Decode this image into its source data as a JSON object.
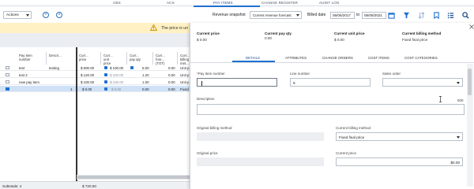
{
  "nav": {
    "tabs": [
      "CBS",
      "ACS",
      "PAY ITEMS",
      "CHANGE REGISTER",
      "AUDIT LOG"
    ],
    "active": "PAY ITEMS"
  },
  "toolbar": {
    "actions_label": "Actions",
    "revenue_snapshot_label": "Revenue snapshot",
    "revenue_snapshot_value": "Current revenue forecast",
    "billed_date_label": "Billed date",
    "date_from": "06/06/2017",
    "to_label": "to",
    "date_to": "06/08/2021"
  },
  "banner": {
    "message": "The price is un"
  },
  "grid": {
    "headers": [
      "Pay item number",
      "Descri...",
      "Curr... price",
      "Curr... unit price",
      "Curr... pay qty",
      "Curr... fore... (TOT)",
      "Curr... billing met..."
    ],
    "rows": [
      {
        "selected": false,
        "number": "test",
        "description": "testing",
        "price": "$ 500.00",
        "unit_price": "$ 100.00",
        "pay_qty": "5.00",
        "fore": "0.00",
        "billing": "Unit p"
      },
      {
        "selected": false,
        "number": "test 2",
        "description": "",
        "price": "$ 120.00",
        "unit_price": "$ 100.00",
        "pay_qty": "1.20",
        "fore": "0.00",
        "billing": "Unit p"
      },
      {
        "selected": false,
        "number": "new pay item",
        "description": "",
        "price": "$ 100.00",
        "unit_price": "$ 100.00",
        "pay_qty": "1.00",
        "fore": "0.00",
        "billing": "Unit p"
      },
      {
        "selected": true,
        "number": "",
        "description": "",
        "price": "$ 0.00",
        "unit_price": "$ 0.00",
        "pay_qty": "0.00",
        "fore": "0.00",
        "billing": "Fixed"
      }
    ]
  },
  "footer": {
    "subtotals": "Subtotals: 4",
    "price_total": "$ 720.00"
  },
  "panel": {
    "summary": [
      {
        "label": "Current price",
        "value": "$ 0.00"
      },
      {
        "label": "Current pay qty",
        "value": "0.00"
      },
      {
        "label": "Current unit price",
        "value": "$ 0.00"
      },
      {
        "label": "Current billing method",
        "value": "Fixed final price"
      }
    ],
    "tabs": [
      "DETAILS",
      "ATTRIBUTES",
      "CHANGE ORDERS",
      "COST ITEMS",
      "COST CATEGORIES"
    ],
    "active_tab": "DETAILS",
    "fields": {
      "pay_item_number_label": "Pay item number",
      "pay_item_number_value": "",
      "line_number_label": "Line number",
      "line_number_value": "9",
      "sales_order_label": "Sales order",
      "sales_order_value": "",
      "description_label": "Description",
      "description_counter": "500",
      "original_billing_label": "Original billing method",
      "original_billing_value": "",
      "current_billing_label": "Current billing method",
      "current_billing_value": "Fixed final price",
      "original_price_label": "Original price",
      "original_price_value": "",
      "current_price_label": "Current price",
      "current_price_value": "$0.00"
    }
  },
  "colors": {
    "accent": "#1f6fcf",
    "banner": "#fff1c4",
    "selected_row": "#cfe1f7"
  }
}
